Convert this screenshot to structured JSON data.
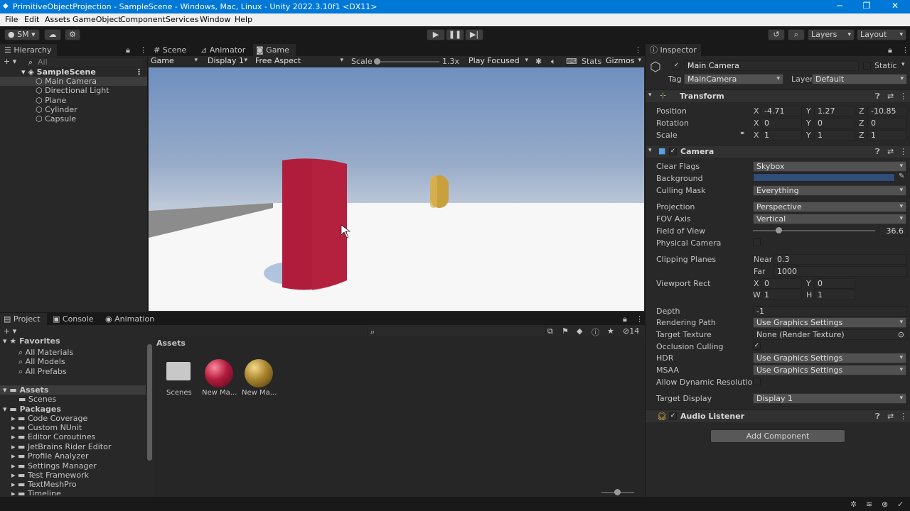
{
  "window": {
    "title": "PrimitiveObjectProjection - SampleScene - Windows, Mac, Linux - Unity 2022.3.10f1 <DX11>",
    "minimize": "─",
    "maximize": "❐",
    "close": "✕"
  },
  "menu": [
    "File",
    "Edit",
    "Assets",
    "GameObject",
    "Component",
    "Services",
    "Window",
    "Help"
  ],
  "toolbar": {
    "account": "SM",
    "layers": "Layers",
    "layout": "Layout"
  },
  "hierarchy": {
    "tab": "Hierarchy",
    "search_placeholder": "All",
    "scene": "SampleScene",
    "items": [
      "Main Camera",
      "Directional Light",
      "Plane",
      "Cylinder",
      "Capsule"
    ]
  },
  "center_tabs": [
    "Scene",
    "Animator",
    "Game"
  ],
  "game_bar": {
    "mode": "Game",
    "display": "Display 1",
    "aspect": "Free Aspect",
    "scale_label": "Scale",
    "scale_value": "1.3x",
    "play_focused": "Play Focused",
    "stats": "Stats",
    "gizmos": "Gizmos"
  },
  "bottom_tabs": [
    "Project",
    "Console",
    "Animation"
  ],
  "project": {
    "favorites_label": "Favorites",
    "favorites": [
      "All Materials",
      "All Models",
      "All Prefabs"
    ],
    "assets_label": "Assets",
    "assets_children": [
      "Scenes"
    ],
    "packages_label": "Packages",
    "packages": [
      "Code Coverage",
      "Custom NUnit",
      "Editor Coroutines",
      "JetBrains Rider Editor",
      "Profile Analyzer",
      "Settings Manager",
      "Test Framework",
      "TextMeshPro",
      "Timeline"
    ],
    "breadcrumb": "Assets",
    "hidden_count": "14",
    "grid": [
      {
        "name": "Scenes",
        "kind": "folder"
      },
      {
        "name": "New Ma...",
        "kind": "material",
        "color": "#b01c3c"
      },
      {
        "name": "New Ma...",
        "kind": "material",
        "color": "#a8842c"
      }
    ]
  },
  "inspector": {
    "tab": "Inspector",
    "object_name": "Main Camera",
    "static_label": "Static",
    "tag_label": "Tag",
    "tag": "MainCamera",
    "layer_label": "Layer",
    "layer": "Default",
    "transform": {
      "title": "Transform",
      "position_label": "Position",
      "position": {
        "x": "-4.71",
        "y": "1.27",
        "z": "-10.85"
      },
      "rotation_label": "Rotation",
      "rotation": {
        "x": "0",
        "y": "0",
        "z": "0"
      },
      "scale_label": "Scale",
      "scale": {
        "x": "1",
        "y": "1",
        "z": "1"
      }
    },
    "camera": {
      "title": "Camera",
      "clear_flags_label": "Clear Flags",
      "clear_flags": "Skybox",
      "background_label": "Background",
      "background_color": "#314d79",
      "culling_mask_label": "Culling Mask",
      "culling_mask": "Everything",
      "projection_label": "Projection",
      "projection": "Perspective",
      "fov_axis_label": "FOV Axis",
      "fov_axis": "Vertical",
      "fov_label": "Field of View",
      "fov": "36.6",
      "fov_fraction": 0.21,
      "physical_label": "Physical Camera",
      "clipping_label": "Clipping Planes",
      "near_label": "Near",
      "near": "0.3",
      "far_label": "Far",
      "far": "1000",
      "viewport_label": "Viewport Rect",
      "vp": {
        "x": "0",
        "y": "0",
        "w": "1",
        "h": "1"
      },
      "depth_label": "Depth",
      "depth": "-1",
      "rendering_label": "Rendering Path",
      "rendering": "Use Graphics Settings",
      "target_texture_label": "Target Texture",
      "target_texture": "None (Render Texture)",
      "occlusion_label": "Occlusion Culling",
      "hdr_label": "HDR",
      "hdr": "Use Graphics Settings",
      "msaa_label": "MSAA",
      "msaa": "Use Graphics Settings",
      "dynres_label": "Allow Dynamic Resolution",
      "target_display_label": "Target Display",
      "target_display": "Display 1"
    },
    "audio": {
      "title": "Audio Listener"
    },
    "add_component": "Add Component"
  },
  "axis": {
    "x": "X",
    "y": "Y",
    "z": "Z",
    "w": "W",
    "h": "H"
  }
}
